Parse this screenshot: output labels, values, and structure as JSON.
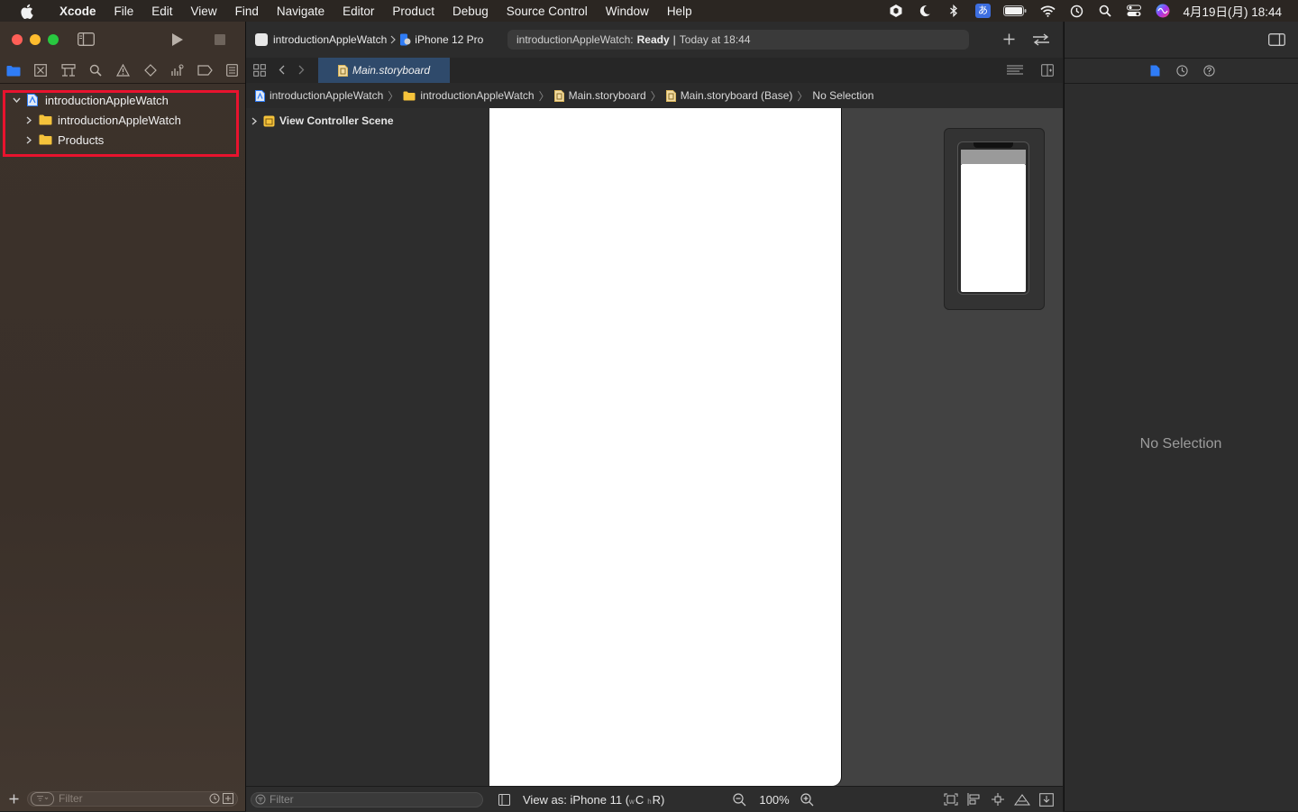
{
  "menubar": {
    "app_name": "Xcode",
    "items": [
      "File",
      "Edit",
      "View",
      "Find",
      "Navigate",
      "Editor",
      "Product",
      "Debug",
      "Source Control",
      "Window",
      "Help"
    ],
    "input_method": "あ",
    "clock": "4月19日(月) 18:44"
  },
  "toolbar": {
    "scheme_name": "introductionAppleWatch",
    "destination": "iPhone 12 Pro",
    "activity_project": "introductionAppleWatch:",
    "activity_status": "Ready",
    "activity_time": "Today at 18:44"
  },
  "navigator": {
    "tree": [
      {
        "label": "introductionAppleWatch",
        "level": 0,
        "expanded": true,
        "kind": "project"
      },
      {
        "label": "introductionAppleWatch",
        "level": 1,
        "expanded": false,
        "kind": "folder"
      },
      {
        "label": "Products",
        "level": 1,
        "expanded": false,
        "kind": "folder"
      }
    ],
    "filter_placeholder": "Filter"
  },
  "editor": {
    "active_tab": "Main.storyboard",
    "jumpbar": [
      "introductionAppleWatch",
      "introductionAppleWatch",
      "Main.storyboard",
      "Main.storyboard (Base)",
      "No Selection"
    ],
    "outline_scene": "View Controller Scene",
    "outline_filter_placeholder": "Filter",
    "view_as_prefix": "View as: iPhone 11 (",
    "view_as_w": "C",
    "view_as_h": "R)",
    "zoom": "100%"
  },
  "inspector": {
    "empty_text": "No Selection"
  },
  "colors": {
    "accent": "#2f7cf6",
    "highlight": "#e8132e",
    "folder": "#f5c33b"
  }
}
